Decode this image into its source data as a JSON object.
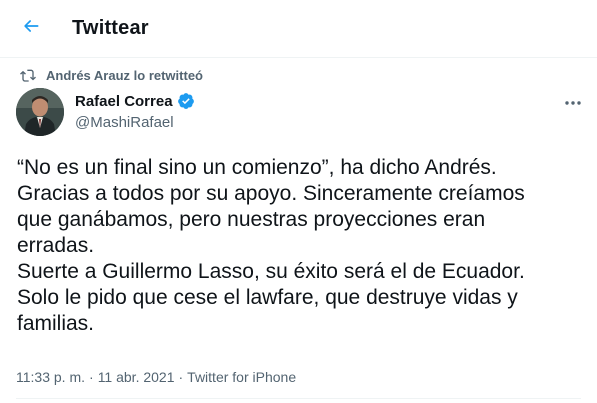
{
  "header": {
    "title": "Twittear",
    "back_icon": "arrow-left-icon"
  },
  "retweet_context": {
    "icon": "retweet-icon",
    "text": "Andrés Arauz lo retwitteó"
  },
  "author": {
    "name": "Rafael Correa",
    "handle": "@MashiRafael",
    "verified": true,
    "avatar_icon": "user-avatar"
  },
  "tweet": {
    "lines": [
      "“No es un final sino un comienzo”, ha dicho Andrés.",
      "Gracias a todos por su apoyo. Sinceramente creíamos",
      "que ganábamos, pero nuestras proyecciones eran",
      "erradas.",
      "Suerte a Guillermo Lasso, su éxito será el de Ecuador.",
      "Solo le pido que cese el lawfare, que destruye vidas y",
      "familias."
    ]
  },
  "meta": {
    "time": "11:33 p. m.",
    "separator1": "·",
    "date": "11 abr. 2021",
    "separator2": "·",
    "source": "Twitter for iPhone"
  },
  "colors": {
    "accent": "#1d9bf0",
    "text_primary": "#0f1419",
    "text_secondary": "#536471"
  }
}
